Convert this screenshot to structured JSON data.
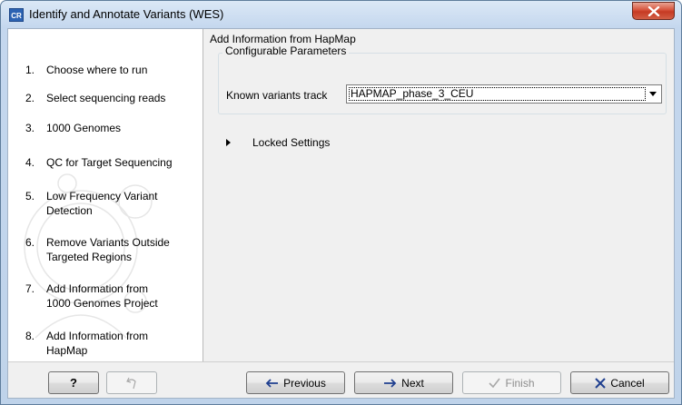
{
  "window": {
    "title": "Identify and Annotate Variants (WES)",
    "app_icon_text": "CR"
  },
  "sidebar": {
    "steps": [
      {
        "num": "1.",
        "label": "Choose where to run"
      },
      {
        "num": "2.",
        "label": "Select sequencing reads"
      },
      {
        "num": "3.",
        "label": "1000 Genomes"
      },
      {
        "num": "4.",
        "label": "QC for Target Sequencing"
      },
      {
        "num": "5.",
        "label": "Low Frequency Variant Detection"
      },
      {
        "num": "6.",
        "label": "Remove Variants Outside Targeted Regions"
      },
      {
        "num": "7.",
        "label": "Add Information from 1000 Genomes Project"
      },
      {
        "num": "8.",
        "label": "Add Information from HapMap"
      }
    ]
  },
  "content": {
    "title": "Add Information from HapMap",
    "group_title": "Configurable Parameters",
    "known_variants_label": "Known variants track",
    "known_variants_value": "HAPMAP_phase_3_CEU",
    "locked_settings_label": "Locked Settings"
  },
  "footer": {
    "help_label": "?",
    "previous_label": "Previous",
    "next_label": "Next",
    "finish_label": "Finish",
    "cancel_label": "Cancel"
  },
  "colors": {
    "title_bar": "#c4d7ee",
    "close_button": "#c63a23",
    "next_arrow": "#1f3f8f",
    "cancel_x": "#1f3f8f"
  }
}
